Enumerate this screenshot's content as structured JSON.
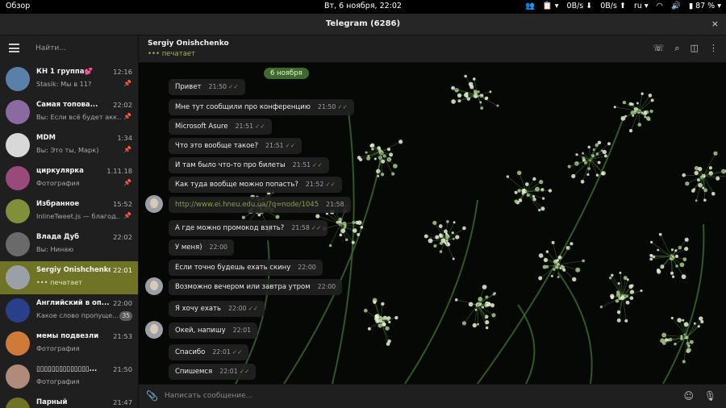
{
  "topbar": {
    "overview": "Обзор",
    "clock": "Вт, 6 ноября, 22:02",
    "net_down": "0B/s",
    "net_up": "0B/s",
    "lang": "ru",
    "battery": "87 %"
  },
  "window": {
    "title": "Telegram (6286)",
    "close": "×"
  },
  "sidebar": {
    "search_placeholder": "Найти...",
    "chats": [
      {
        "name": "КН 1 группа💕",
        "time": "12:16",
        "preview": "Stasik: Мы в 11?",
        "pinned": true,
        "color": "#5a7fa8"
      },
      {
        "name": "Самая топова...",
        "time": "22:02",
        "preview": "Вы: Если всё будет акк...",
        "pinned": true,
        "color": "#8a6aa0"
      },
      {
        "name": "MDM",
        "time": "1:34",
        "preview": "Вы: Это ты, Марк)",
        "pinned": true,
        "color": "#d8d8d8"
      },
      {
        "name": "циркулярка",
        "time": "1.11.18",
        "preview": "Фотография",
        "pinned": true,
        "color": "#9a4a7a"
      },
      {
        "name": "Избранное",
        "time": "15:52",
        "preview": "InlineTweet.js — благод...",
        "pinned": true,
        "color": "#7f8f3a"
      },
      {
        "name": "Влада Дуб",
        "time": "22:02",
        "preview": "Вы: Нинаю",
        "pinned": false,
        "color": "#6a6a6a"
      },
      {
        "name": "Sergiy Onishchenko",
        "time": "22:01",
        "preview": "••• печатает",
        "pinned": false,
        "color": "#9aa0a6"
      },
      {
        "name": "Английский в оп...",
        "time": "22:00",
        "preview": "Какое слово пропуще...",
        "badge": "35",
        "color": "#2a3f8a"
      },
      {
        "name": "мемы подвезли",
        "time": "21:53",
        "preview": "Фотография",
        "pinned": false,
        "color": "#d07a3a"
      },
      {
        "name": "▯▯▯▯▯▯▯▯▯▯▯▯▯▯...",
        "time": "21:50",
        "preview": "Фотография",
        "pinned": false,
        "color": "#b08a7a"
      },
      {
        "name": "Парный",
        "time": "21:47",
        "preview": "",
        "pinned": false,
        "color": "#6e7326"
      }
    ]
  },
  "chat": {
    "name": "Sergiy Onishchenko",
    "status": "••• печатает",
    "date": "6 ноября",
    "messages": [
      {
        "text": "Привет",
        "time": "21:50",
        "out": true
      },
      {
        "text": "Мне тут сообщили про конференцию",
        "time": "21:50",
        "out": true
      },
      {
        "text": "Microsoft Asure",
        "time": "21:51",
        "out": true
      },
      {
        "text": "Что это вообще такое?",
        "time": "21:51",
        "out": true
      },
      {
        "text": "И там было что-то про билеты",
        "time": "21:51",
        "out": true
      },
      {
        "text": "Как туда вообще можно попасть?",
        "time": "21:52",
        "out": true
      },
      {
        "text": "http://www.ei.hneu.edu.ua/?q=node/1045",
        "time": "21:58",
        "out": false,
        "link": true
      },
      {
        "text": "А где можно промокод взять?",
        "time": "21:58",
        "out": true
      },
      {
        "text": "У меня)",
        "time": "22:00",
        "out": false
      },
      {
        "text": "Если точно будешь ехать скину",
        "time": "22:00",
        "out": false
      },
      {
        "text": "Возможно вечером или завтра утром",
        "time": "22:00",
        "out": false
      },
      {
        "text": "Я хочу ехать",
        "time": "22:00",
        "out": true
      },
      {
        "text": "Окей, напишу",
        "time": "22:01",
        "out": false
      },
      {
        "text": "Спасибо",
        "time": "22:01",
        "out": true
      },
      {
        "text": "Спишемся",
        "time": "22:01",
        "out": true
      }
    ]
  },
  "compose": {
    "placeholder": "Написать сообщение..."
  },
  "colors": {
    "accent": "#6e7326",
    "typing": "#a2b35a",
    "date_pill": "#3f6a2e"
  }
}
